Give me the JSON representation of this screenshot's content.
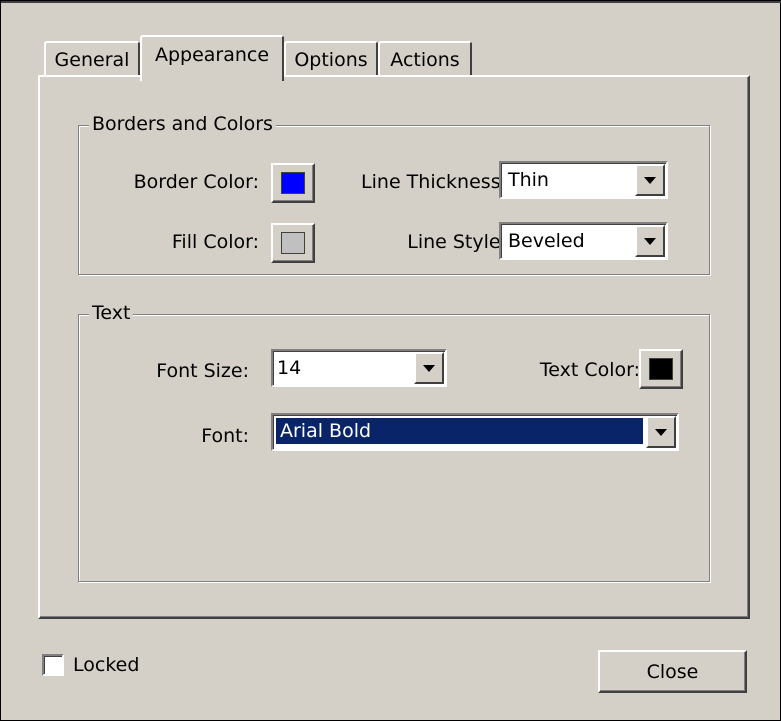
{
  "tabs": [
    {
      "label": "General",
      "active": false
    },
    {
      "label": "Appearance",
      "active": true
    },
    {
      "label": "Options",
      "active": false
    },
    {
      "label": "Actions",
      "active": false
    }
  ],
  "borders_group": {
    "title": "Borders and Colors",
    "border_color_label": "Border Color:",
    "border_color": "#0000ff",
    "fill_color_label": "Fill Color:",
    "fill_color": "#c0c0c0",
    "line_thickness_label": "Line Thickness:",
    "line_thickness_value": "Thin",
    "line_style_label": "Line Style:",
    "line_style_value": "Beveled"
  },
  "text_group": {
    "title": "Text",
    "font_size_label": "Font Size:",
    "font_size_value": "14",
    "text_color_label": "Text Color:",
    "text_color": "#000000",
    "font_label": "Font:",
    "font_value": "Arial Bold"
  },
  "footer": {
    "locked_label": "Locked",
    "locked_checked": false,
    "close_label": "Close"
  },
  "colors": {
    "face": "#d4d0c8",
    "selection": "#0a246a"
  }
}
